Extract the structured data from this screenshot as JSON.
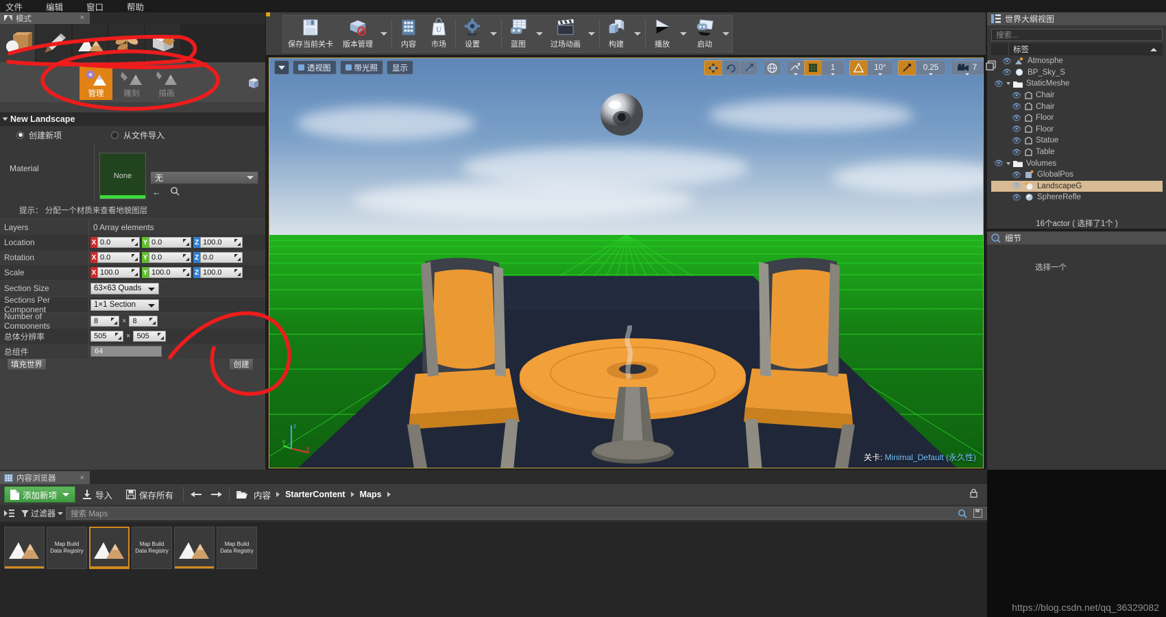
{
  "menu": {
    "items": [
      {
        "label": "文件",
        "name": "menu-file"
      },
      {
        "label": "编辑",
        "name": "menu-edit"
      },
      {
        "label": "窗口",
        "name": "menu-window"
      },
      {
        "label": "帮助",
        "name": "menu-help"
      }
    ]
  },
  "modes_panel": {
    "tab_label": "模式",
    "close": "×",
    "mode_buttons": [
      {
        "name": "mode-place",
        "icon": "place-cube-icon",
        "selected": true
      },
      {
        "name": "mode-paint",
        "icon": "paint-brush-icon",
        "selected": false
      },
      {
        "name": "mode-landscape",
        "icon": "landscape-mountain-icon",
        "selected": false
      },
      {
        "name": "mode-foliage",
        "icon": "foliage-leaf-icon",
        "selected": false
      },
      {
        "name": "mode-geometry",
        "icon": "geometry-edit-icon",
        "selected": false
      }
    ],
    "sub_modes": [
      {
        "label": "管理",
        "name": "submode-manage",
        "active": true
      },
      {
        "label": "雕刻",
        "name": "submode-sculpt",
        "active": false
      },
      {
        "label": "描画",
        "name": "submode-paint",
        "active": false
      }
    ]
  },
  "new_landscape": {
    "header": "New Landscape",
    "radio_new": "创建新项",
    "radio_import": "从文件导入",
    "radio_selected": "new",
    "material_label": "Material",
    "material_thumb_text": "None",
    "material_combo_value": "无",
    "hint": "提示： 分配一个材质来查看地貌图层",
    "rows": [
      {
        "label": "Layers",
        "value": "0 Array elements",
        "name": "row-layers"
      },
      {
        "label": "Location",
        "name": "row-location",
        "vector": {
          "x": "0.0",
          "y": "0.0",
          "z": "100.0"
        }
      },
      {
        "label": "Rotation",
        "name": "row-rotation",
        "vector": {
          "x": "0.0",
          "y": "0.0",
          "z": "0.0"
        }
      },
      {
        "label": "Scale",
        "name": "row-scale",
        "vector": {
          "x": "100.0",
          "y": "100.0",
          "z": "100.0"
        }
      }
    ],
    "section_size_label": "Section Size",
    "section_size_value": "63×63 Quads",
    "sections_per_component_label": "Sections Per Component",
    "sections_per_component_value": "1×1 Section",
    "number_of_components_label": "Number of Components",
    "number_of_components_x": "8",
    "number_of_components_y": "8",
    "overall_resolution_label": "总体分辨率",
    "overall_resolution_x": "505",
    "overall_resolution_y": "505",
    "total_components_label": "总组件",
    "total_components_value": "64",
    "fill_world_button": "填充世界",
    "create_button": "创建"
  },
  "main_toolbar": {
    "items": [
      {
        "label": "保存当前关卡",
        "name": "toolbar-save-level",
        "icon": "floppy-disk-icon",
        "arrow": false
      },
      {
        "label": "版本管理",
        "name": "toolbar-source-control",
        "icon": "source-control-icon",
        "arrow": true
      },
      {
        "label": "内容",
        "name": "toolbar-content",
        "icon": "content-grid-icon",
        "arrow": false
      },
      {
        "label": "市场",
        "name": "toolbar-marketplace",
        "icon": "marketplace-bag-icon",
        "arrow": false
      },
      {
        "label": "设置",
        "name": "toolbar-settings",
        "icon": "gear-icon",
        "arrow": true
      },
      {
        "label": "蓝图",
        "name": "toolbar-blueprints",
        "icon": "blueprint-icon",
        "arrow": true
      },
      {
        "label": "过场动画",
        "name": "toolbar-cinematics",
        "icon": "clapperboard-icon",
        "arrow": true
      },
      {
        "label": "构建",
        "name": "toolbar-build",
        "icon": "build-cubes-icon",
        "arrow": true
      },
      {
        "label": "播放",
        "name": "toolbar-play",
        "icon": "play-triangle-icon",
        "arrow": true
      },
      {
        "label": "启动",
        "name": "toolbar-launch",
        "icon": "launch-monitor-icon",
        "arrow": true
      }
    ]
  },
  "viewport": {
    "overlay_left": [
      {
        "label": "透视图",
        "name": "viewport-perspective-button",
        "icon": "camera-icon"
      },
      {
        "label": "带光照",
        "name": "viewport-lit-button",
        "icon": "lightbulb-icon"
      },
      {
        "label": "显示",
        "name": "viewport-show-button",
        "icon": "show-icon"
      }
    ],
    "overlay_right": [
      {
        "label": "",
        "name": "transform-move-tool",
        "icon": "move-arrows-icon",
        "active": true
      },
      {
        "label": "",
        "name": "transform-rotate-tool",
        "icon": "rotate-icon",
        "active": false
      },
      {
        "label": "",
        "name": "transform-scale-tool",
        "icon": "scale-icon",
        "active": false
      },
      {
        "label": "",
        "name": "world-space-toggle",
        "icon": "globe-icon",
        "active": false
      },
      {
        "label": "",
        "name": "surface-snap-toggle",
        "icon": "surface-snap-icon",
        "active": false
      },
      {
        "label": "",
        "name": "grid-snap-toggle",
        "icon": "grid-icon",
        "active": true
      },
      {
        "label": "1",
        "name": "grid-snap-value",
        "icon": "",
        "active": false
      },
      {
        "label": "",
        "name": "rotation-snap-toggle",
        "icon": "angle-icon",
        "active": true
      },
      {
        "label": "10°",
        "name": "rotation-snap-value",
        "icon": "",
        "active": false
      },
      {
        "label": "",
        "name": "scale-snap-toggle",
        "icon": "scale-snap-icon",
        "active": true
      },
      {
        "label": "0.25",
        "name": "scale-snap-value",
        "icon": "",
        "active": false
      },
      {
        "label": "7",
        "name": "camera-speed-value",
        "icon": "camera-speed-icon",
        "active": false
      }
    ],
    "level_prefix": "关卡:",
    "level_name": "Minimal_Default (永久性)",
    "maximize_icon": "maximize-viewport-icon"
  },
  "outliner": {
    "tab_label": "世界大纲视图",
    "search_placeholder": "搜索...",
    "column_header": "标签",
    "items": [
      {
        "label": "Atmosphe",
        "indent": 1,
        "icon": "atmosphere-icon",
        "selected": false
      },
      {
        "label": "BP_Sky_S",
        "indent": 1,
        "icon": "sphere-icon",
        "selected": false
      },
      {
        "label": "StaticMeshe",
        "indent": 0,
        "icon": "folder-icon",
        "selected": false
      },
      {
        "label": "Chair",
        "indent": 1,
        "icon": "mesh-icon",
        "selected": false
      },
      {
        "label": "Chair",
        "indent": 1,
        "icon": "mesh-icon",
        "selected": false
      },
      {
        "label": "Floor",
        "indent": 1,
        "icon": "mesh-icon",
        "selected": false
      },
      {
        "label": "Floor",
        "indent": 1,
        "icon": "mesh-icon",
        "selected": false
      },
      {
        "label": "Statue",
        "indent": 1,
        "icon": "mesh-icon",
        "selected": false
      },
      {
        "label": "Table",
        "indent": 1,
        "icon": "mesh-icon",
        "selected": false
      },
      {
        "label": "Volumes",
        "indent": 0,
        "icon": "folder-icon",
        "selected": false
      },
      {
        "label": "GlobalPos",
        "indent": 1,
        "icon": "volume-icon",
        "selected": false
      },
      {
        "label": "LandscapeG",
        "indent": 1,
        "icon": "sphere-icon",
        "selected": true
      },
      {
        "label": "SphereRefle",
        "indent": 1,
        "icon": "reflection-icon",
        "selected": false
      }
    ],
    "status": "16个actor ( 选择了1个 )"
  },
  "details": {
    "tab_label": "细节",
    "message": "选择一个"
  },
  "content_browser": {
    "tab_label": "内容浏览器",
    "close": "×",
    "add_new": "添加新项",
    "import": "导入",
    "save_all": "保存所有",
    "back_icon": "arrow-left-icon",
    "forward_icon": "arrow-right-icon",
    "breadcrumb": [
      "内容",
      "StarterContent",
      "Maps"
    ],
    "filter_label": "过滤器",
    "search_placeholder": "搜索 Maps",
    "assets": [
      {
        "label": "",
        "name": "asset-map-1",
        "selected": false,
        "type": "map"
      },
      {
        "label": "Map Build Data Registry",
        "name": "asset-mapbuilddata-1",
        "selected": false,
        "type": "text"
      },
      {
        "label": "",
        "name": "asset-map-2",
        "selected": true,
        "type": "map"
      },
      {
        "label": "Map Build Data Registry",
        "name": "asset-mapbuilddata-2",
        "selected": false,
        "type": "text"
      },
      {
        "label": "",
        "name": "asset-map-3",
        "selected": false,
        "type": "map"
      },
      {
        "label": "Map Build Data Registry",
        "name": "asset-mapbuilddata-3",
        "selected": false,
        "type": "text"
      }
    ]
  },
  "watermark": "https://blog.csdn.net/qq_36329082",
  "colors": {
    "accent_orange": "#e08214",
    "viewport_border": "#c8a23a",
    "annotation_red": "#ee1c1c",
    "add_new_green": "#3f9a40"
  }
}
